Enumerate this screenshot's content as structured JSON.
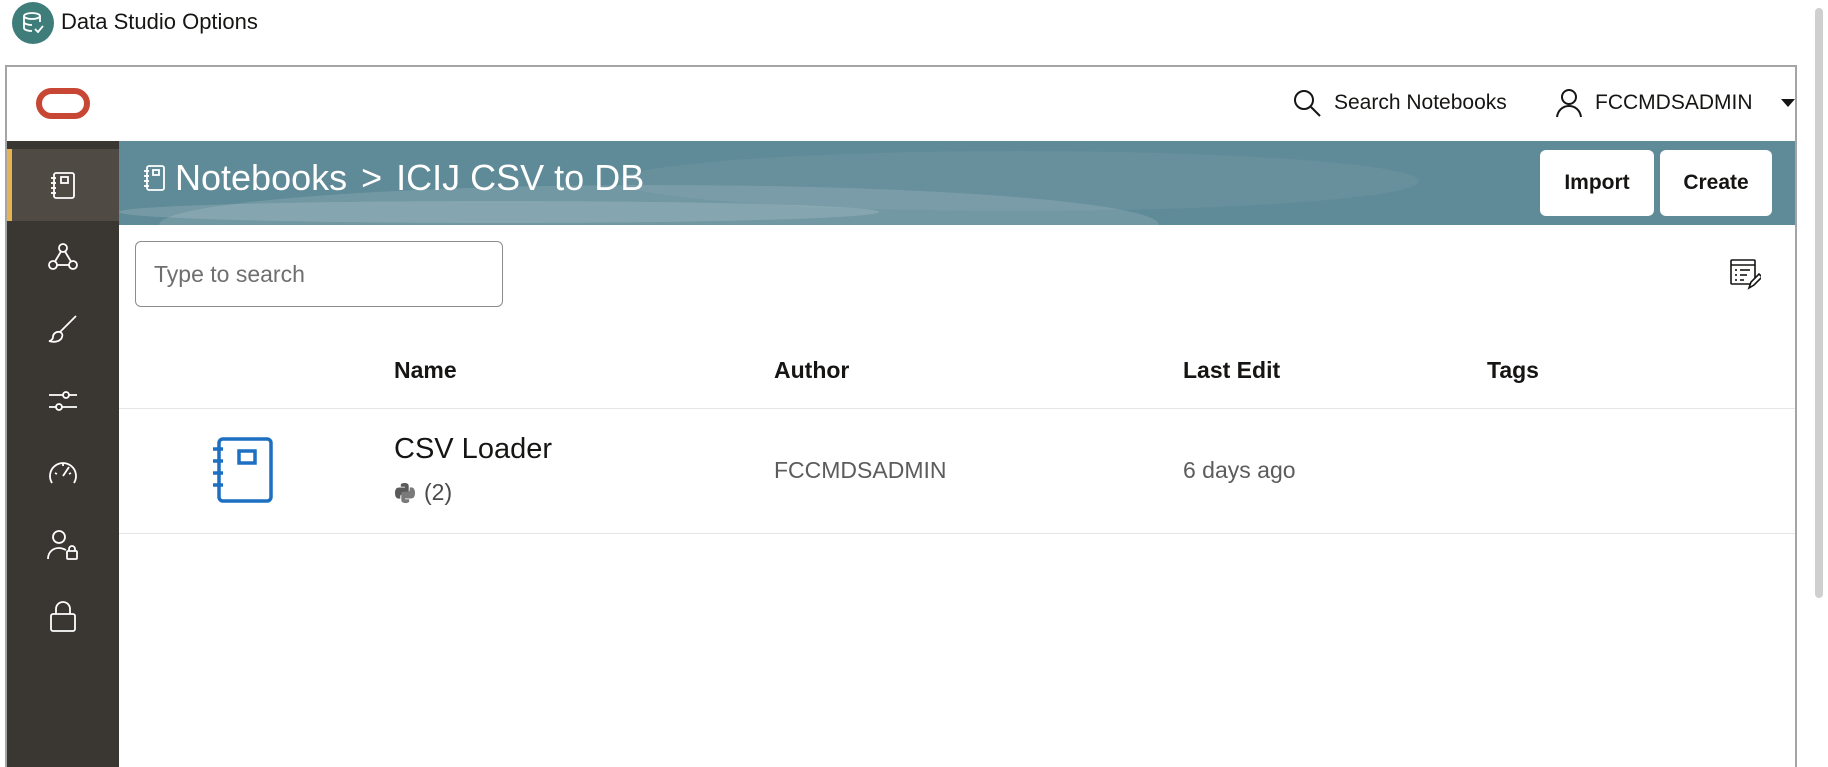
{
  "app": {
    "title": "Data Studio Options",
    "logo_icon": "database-check-icon"
  },
  "topbar": {
    "logo": "oracle-logo",
    "search_label": "Search Notebooks",
    "user_name": "FCCMDSADMIN"
  },
  "sidenav": {
    "items": [
      {
        "name": "notebooks",
        "icon": "notebook-icon",
        "active": true
      },
      {
        "name": "graph",
        "icon": "graph-nodes-icon",
        "active": false
      },
      {
        "name": "paint",
        "icon": "brush-icon",
        "active": false
      },
      {
        "name": "settings",
        "icon": "sliders-icon",
        "active": false
      },
      {
        "name": "dashboard",
        "icon": "gauge-icon",
        "active": false
      },
      {
        "name": "users",
        "icon": "user-lock-icon",
        "active": false
      },
      {
        "name": "security",
        "icon": "lock-icon",
        "active": false
      }
    ]
  },
  "header": {
    "breadcrumb_root": "Notebooks",
    "breadcrumb_sep": ">",
    "breadcrumb_current": "ICIJ CSV to DB",
    "import_label": "Import",
    "create_label": "Create"
  },
  "search": {
    "placeholder": "Type to search",
    "value": ""
  },
  "table": {
    "columns": [
      "Name",
      "Author",
      "Last Edit",
      "Tags"
    ],
    "rows": [
      {
        "name": "CSV Loader",
        "paragraphs": "(2)",
        "language_icon": "python-icon",
        "author": "FCCMDSADMIN",
        "last_edit": "6 days ago",
        "tags": ""
      }
    ]
  },
  "colors": {
    "banner": "#5f8a97",
    "sidenav": "#3a3631",
    "active_indicator": "#e7b352",
    "oracle_red": "#c74634",
    "notebook_blue": "#1d6fc2",
    "app_logo": "#3f7d7b"
  }
}
